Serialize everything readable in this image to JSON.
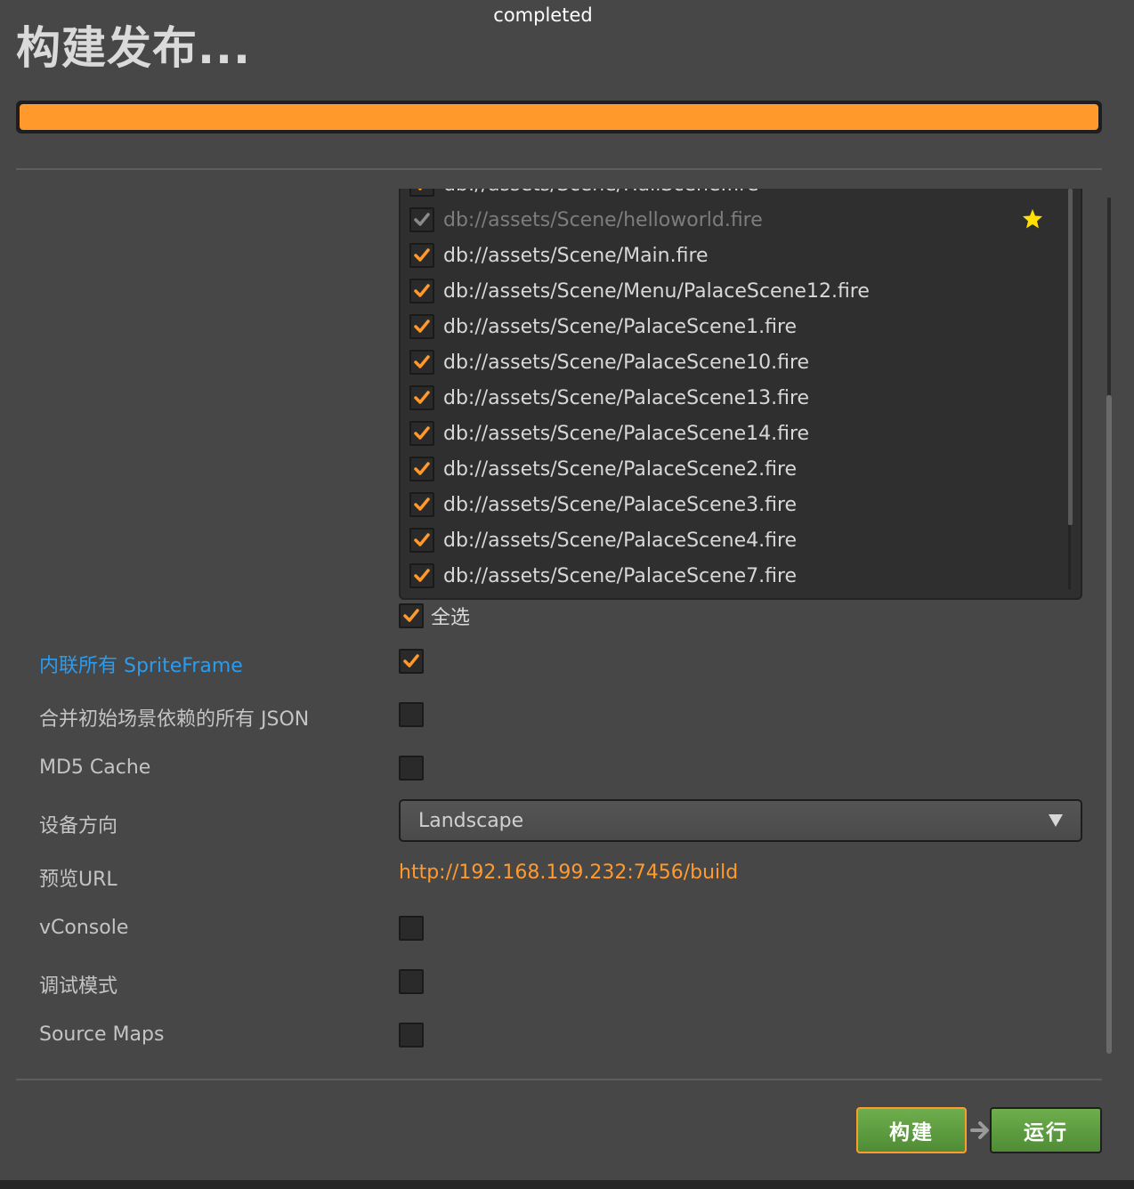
{
  "header": {
    "title": "构建发布...",
    "progress_text": "completed",
    "progress_value": 1.0
  },
  "scenes": {
    "items": [
      {
        "path": "db://assets/Scene/HallScene.fire",
        "checked": true,
        "disabled": false
      },
      {
        "path": "db://assets/Scene/helloworld.fire",
        "checked": true,
        "disabled": true,
        "start_scene": true
      },
      {
        "path": "db://assets/Scene/Main.fire",
        "checked": true,
        "disabled": false
      },
      {
        "path": "db://assets/Scene/Menu/PalaceScene12.fire",
        "checked": true,
        "disabled": false
      },
      {
        "path": "db://assets/Scene/PalaceScene1.fire",
        "checked": true,
        "disabled": false
      },
      {
        "path": "db://assets/Scene/PalaceScene10.fire",
        "checked": true,
        "disabled": false
      },
      {
        "path": "db://assets/Scene/PalaceScene13.fire",
        "checked": true,
        "disabled": false
      },
      {
        "path": "db://assets/Scene/PalaceScene14.fire",
        "checked": true,
        "disabled": false
      },
      {
        "path": "db://assets/Scene/PalaceScene2.fire",
        "checked": true,
        "disabled": false
      },
      {
        "path": "db://assets/Scene/PalaceScene3.fire",
        "checked": true,
        "disabled": false
      },
      {
        "path": "db://assets/Scene/PalaceScene4.fire",
        "checked": true,
        "disabled": false
      },
      {
        "path": "db://assets/Scene/PalaceScene7.fire",
        "checked": true,
        "disabled": false
      }
    ],
    "select_all_label": "全选",
    "select_all_checked": true
  },
  "options": {
    "inline_spriteframe": {
      "label": "内联所有 SpriteFrame",
      "checked": true
    },
    "merge_json": {
      "label": "合并初始场景依赖的所有 JSON",
      "checked": false
    },
    "md5_cache": {
      "label": "MD5 Cache",
      "checked": false
    },
    "orientation": {
      "label": "设备方向",
      "value": "Landscape"
    },
    "preview_url": {
      "label": "预览URL",
      "value": "http://192.168.199.232:7456/build"
    },
    "vconsole": {
      "label": "vConsole",
      "checked": false
    },
    "debug_mode": {
      "label": "调试模式",
      "checked": false
    },
    "source_maps": {
      "label": "Source Maps",
      "checked": false
    }
  },
  "actions": {
    "build_label": "构建",
    "run_label": "运行"
  },
  "colors": {
    "accent": "#ff992b",
    "link": "#2a9cf0",
    "button_green": "#5e9e41",
    "background": "#474747"
  },
  "icons": {
    "check": "check-icon",
    "star": "star-icon",
    "dropdown": "triangle-down-icon",
    "arrow": "arrow-right-icon"
  }
}
